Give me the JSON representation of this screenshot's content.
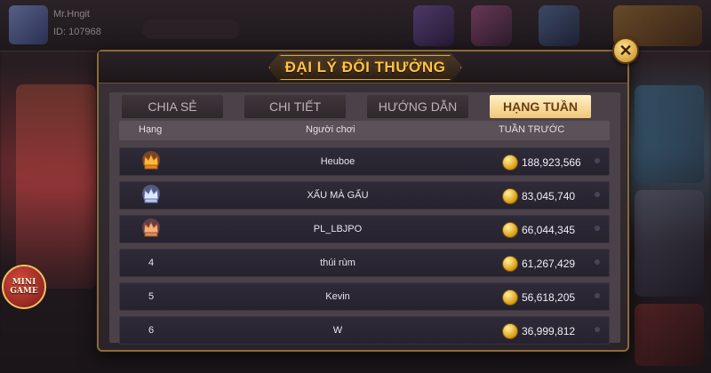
{
  "background": {
    "user": {
      "name": "Mr.Hngit",
      "id": "ID: 107968"
    },
    "mini_game_label": "MINI\nGAME",
    "icons": [
      "lobby-game-icon",
      "lobby-game-icon",
      "lobby-game-icon",
      "lobby-game-icon"
    ]
  },
  "modal": {
    "title": "ĐẠI LÝ ĐỔI THƯỞNG",
    "close_icon": "close-icon",
    "tabs": [
      {
        "label": "CHIA SẺ",
        "active": false
      },
      {
        "label": "CHI TIẾT",
        "active": false
      },
      {
        "label": "HƯỚNG DẪN",
        "active": false
      },
      {
        "label": "HẠNG TUẦN",
        "active": true
      }
    ],
    "table": {
      "columns": {
        "rank": "Hạng",
        "player": "Người chơi",
        "last_week": "TUẦN TRƯỚC"
      },
      "rows": [
        {
          "rank": "1",
          "rank_icon": "gold-crown-icon",
          "player": "Heuboe",
          "amount": "188,923,566"
        },
        {
          "rank": "2",
          "rank_icon": "silver-crown-icon",
          "player": "XẤU MÀ GẤU",
          "amount": "83,045,740"
        },
        {
          "rank": "3",
          "rank_icon": "bronze-crown-icon",
          "player": "PL_LBJPO",
          "amount": "66,044,345"
        },
        {
          "rank": "4",
          "rank_icon": "",
          "player": "thúi rùm",
          "amount": "61,267,429"
        },
        {
          "rank": "5",
          "rank_icon": "",
          "player": "Kevin",
          "amount": "56,618,205"
        },
        {
          "rank": "6",
          "rank_icon": "",
          "player": "W",
          "amount": "36,999,812"
        }
      ]
    }
  },
  "colors": {
    "gold": "#ffc24a",
    "silver": "#c8d6ff",
    "bronze": "#e89a6a",
    "active_tab": "#f2c77a"
  }
}
